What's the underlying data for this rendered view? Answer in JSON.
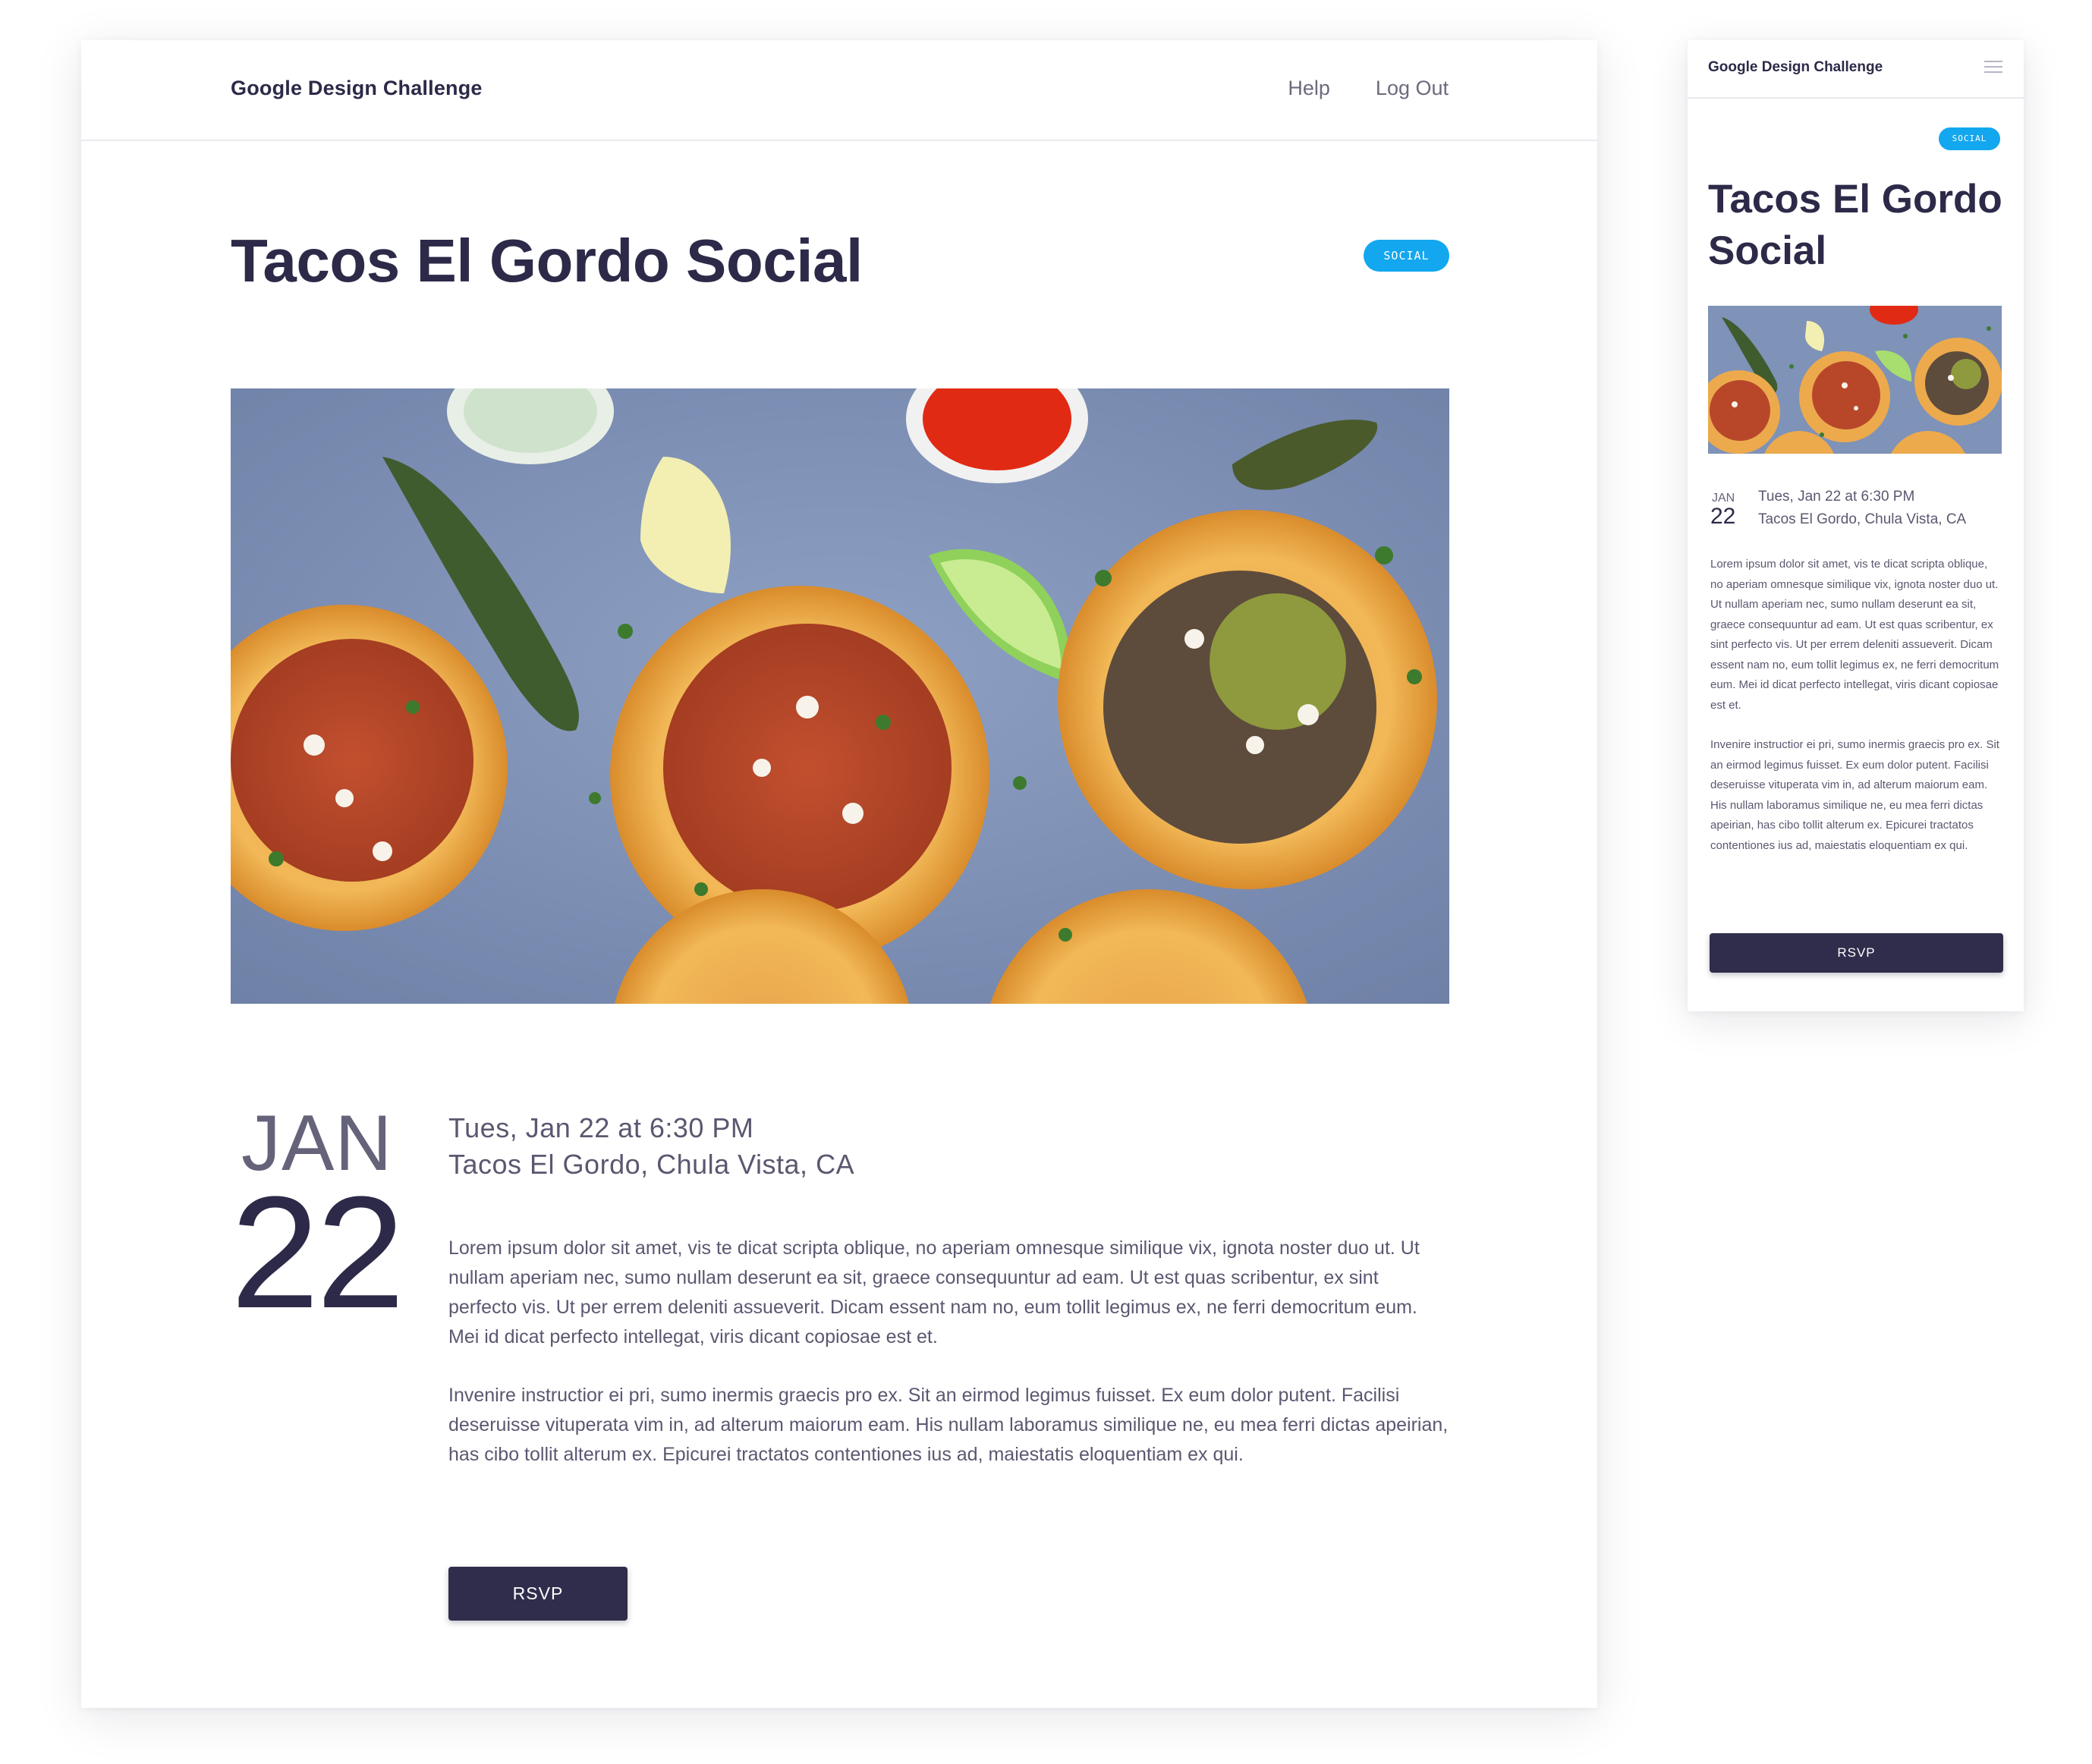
{
  "desktop": {
    "header": {
      "brand": "Google Design Challenge",
      "nav": [
        "Help",
        "Log Out"
      ]
    },
    "event": {
      "title": "Tacos El Gordo Social",
      "badge": "SOCIAL",
      "hero_icon": "tacos-photo",
      "month": "JAN",
      "day": "22",
      "datetime": "Tues, Jan 22 at 6:30 PM",
      "location": "Tacos El Gordo, Chula Vista, CA",
      "paragraphs": [
        "Lorem ipsum dolor sit amet, vis te dicat scripta oblique, no aperiam omnesque similique vix, ignota noster duo ut. Ut nullam aperiam nec, sumo nullam deserunt ea sit, graece consequuntur ad eam. Ut est quas scribentur, ex sint perfecto vis. Ut per errem deleniti assueverit. Dicam essent nam no, eum tollit legimus ex, ne ferri democritum eum. Mei id dicat perfecto intellegat, viris dicant copiosae est et.",
        "Invenire instructior ei pri, sumo inermis graecis pro ex. Sit an eirmod legimus fuisset. Ex eum dolor putent. Facilisi deseruisse vituperata vim in, ad alterum maiorum eam. His nullam laboramus similique ne, eu mea ferri dictas apeirian, has cibo tollit alterum ex. Epicurei tractatos contentiones ius ad, maiestatis eloquentiam ex qui."
      ],
      "rsvp_label": "RSVP"
    }
  },
  "mobile": {
    "header": {
      "brand": "Google Design Challenge",
      "menu_icon": "hamburger-menu-icon"
    },
    "event": {
      "title": "Tacos El Gordo Social",
      "badge": "SOCIAL",
      "month": "JAN",
      "day": "22",
      "datetime": "Tues, Jan 22 at 6:30 PM",
      "location": "Tacos El Gordo, Chula Vista, CA",
      "paragraphs": [
        "Lorem ipsum dolor sit amet, vis te dicat scripta oblique, no aperiam omnesque similique vix, ignota noster duo ut. Ut nullam aperiam nec, sumo nullam deserunt ea sit, graece consequuntur ad eam. Ut est quas scribentur, ex sint perfecto vis. Ut per errem deleniti assueverit. Dicam essent nam no, eum tollit legimus ex, ne ferri democritum eum. Mei id dicat perfecto intellegat, viris dicant copiosae est et.",
        "Invenire instructior ei pri, sumo inermis graecis pro ex. Sit an eirmod legimus fuisset. Ex eum dolor putent. Facilisi deseruisse vituperata vim in, ad alterum maiorum eam. His nullam laboramus similique ne, eu mea ferri dictas apeirian, has cibo tollit alterum ex. Epicurei tractatos contentiones ius ad, maiestatis eloquentiam ex qui."
      ],
      "rsvp_label": "RSVP"
    }
  },
  "colors": {
    "badge": "#13a7ef",
    "button": "#2f2d4b",
    "title": "#2c2a48",
    "body_text": "#5a5870"
  }
}
